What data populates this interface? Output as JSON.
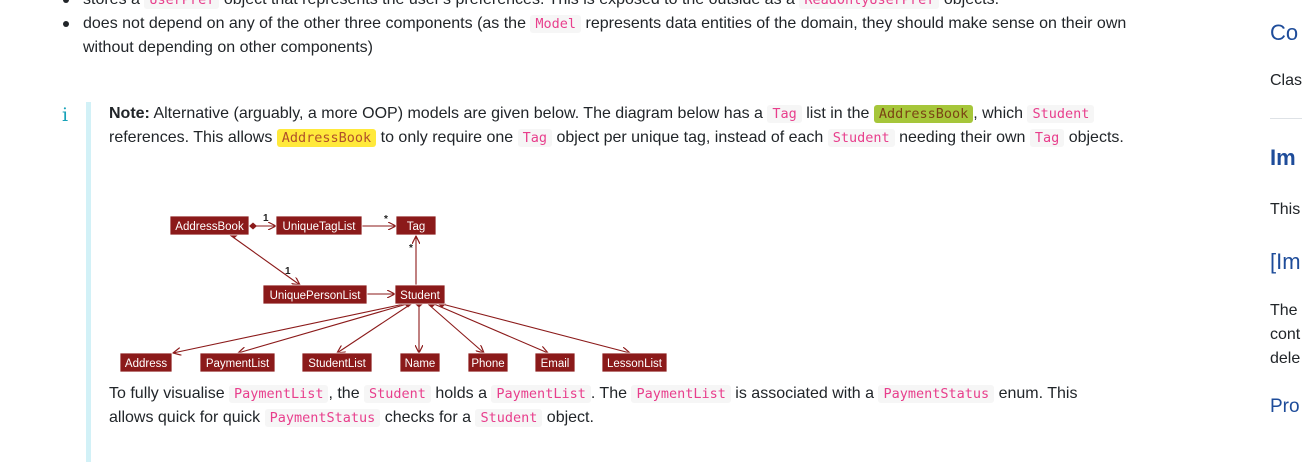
{
  "bullets": [
    {
      "t1": "stores a ",
      "c1": "UserPref",
      "t2": " object that represents the user's preferences. This is exposed to the outside as a ",
      "c2": "ReadOnlyUserPref",
      "t3": " objects."
    },
    {
      "t1": "does not depend on any of the other three components (as the ",
      "c1": "Model",
      "t2": " represents data entities of the domain, they should make sense on their own without depending on other components)"
    }
  ],
  "note": {
    "icon": "i",
    "label": "Note:",
    "t1": " Alternative (arguably, a more OOP) models are given below. The diagram below has a ",
    "c1": "Tag",
    "t2": " list in the ",
    "c2": "AddressBook",
    "t3": ", which ",
    "c3": "Student",
    "t4": " references. This allows ",
    "c4": "AddressBook",
    "t5": " to only require one ",
    "c5": "Tag",
    "t6": " object per unique tag, instead of each ",
    "c6": "Student",
    "t7": " needing their own ",
    "c7": "Tag",
    "t8": " objects."
  },
  "after": {
    "t1": "To fully visualise ",
    "c1": "PaymentList",
    "t2": ", the ",
    "c2": "Student",
    "t3": " holds a ",
    "c3": "PaymentList",
    "t4": ". The ",
    "c4": "PaymentList",
    "t5": " is associated with a ",
    "c5": "PaymentStatus",
    "t6": " enum. This allows quick for quick ",
    "c6": "PaymentStatus",
    "t7": " checks for a ",
    "c7": "Student",
    "t8": " object."
  },
  "diagram": {
    "box_color": "#8b1a1a",
    "classes": {
      "addressbook": "AddressBook",
      "uniquetaglist": "UniqueTagList",
      "tag": "Tag",
      "uniquepersonlist": "UniquePersonList",
      "student": "Student",
      "address": "Address",
      "paymentlist": "PaymentList",
      "studentlist": "StudentList",
      "name": "Name",
      "phone": "Phone",
      "email": "Email",
      "lessonlist": "LessonList"
    },
    "mult": {
      "ab_utl": "1",
      "utl_tag": "*",
      "ab_upl": "1",
      "tag_student": "*"
    }
  },
  "toc": {
    "i1": "Co",
    "i2": "Clas",
    "i3": "Im",
    "i4": "This",
    "i5": "[Im",
    "i6": "The",
    "i7": "cont",
    "i8": "dele",
    "i9": "Pro"
  }
}
